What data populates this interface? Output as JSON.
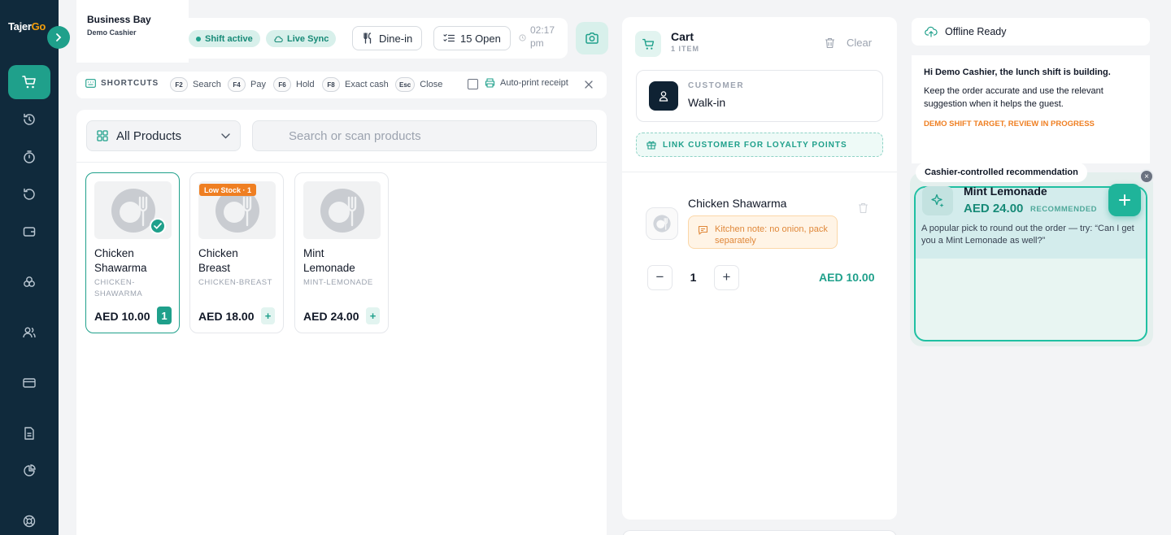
{
  "brand": {
    "name_part1": "Tajer",
    "name_part2": "Go"
  },
  "business": {
    "name": "Business Bay",
    "user": "Demo Cashier"
  },
  "topbar": {
    "shift_status": "Shift active",
    "sync_status": "Live Sync",
    "order_type": "Dine-in",
    "open_orders": "15 Open",
    "time_line1": "02:17",
    "time_line2": "pm"
  },
  "shortcuts": {
    "title": "SHORTCUTS",
    "items": [
      {
        "key": "F2",
        "label": "Search"
      },
      {
        "key": "F4",
        "label": "Pay"
      },
      {
        "key": "F6",
        "label": "Hold"
      },
      {
        "key": "F8",
        "label": "Exact cash"
      },
      {
        "key": "Esc",
        "label": "Close"
      }
    ],
    "auto_print_label": "Auto-print receipt"
  },
  "catalog": {
    "category": "All Products",
    "search_placeholder": "Search or scan products",
    "products": [
      {
        "name_line1": "Chicken",
        "name_line2": "Shawarma",
        "sku_line1": "CHICKEN-",
        "sku_line2": "SHAWARMA",
        "price": "AED 10.00",
        "qty": "1",
        "badge": ""
      },
      {
        "name_line1": "Chicken",
        "name_line2": "Breast",
        "sku_line1": "CHICKEN-BREAST",
        "sku_line2": "",
        "price": "AED 18.00",
        "qty": "",
        "badge": "Low Stock · 1"
      },
      {
        "name_line1": "Mint",
        "name_line2": "Lemonade",
        "sku_line1": "MINT-LEMONADE",
        "sku_line2": "",
        "price": "AED 24.00",
        "qty": "",
        "badge": ""
      }
    ],
    "add_symbol": "+"
  },
  "cart": {
    "title": "Cart",
    "count": "1 ITEM",
    "clear_label": "Clear",
    "customer_label": "CUSTOMER",
    "customer_value": "Walk-in",
    "loyalty_label": "LINK CUSTOMER FOR LOYALTY POINTS",
    "items": [
      {
        "name": "Chicken Shawarma",
        "note": "Kitchen note: no onion, pack separately",
        "qty": "1",
        "price": "AED 10.00"
      }
    ],
    "minus": "−",
    "plus": "+"
  },
  "assistant": {
    "offline_label": "Offline Ready",
    "heading": "Hi Demo Cashier, the lunch shift is building.",
    "body": "Keep the order accurate and use the relevant suggestion when it helps the guest.",
    "target": "DEMO SHIFT TARGET, REVIEW IN PROGRESS"
  },
  "recommendation": {
    "tag": "Cashier-controlled recommendation",
    "name": "Mint Lemonade",
    "price": "AED 24.00",
    "label": "RECOMMENDED",
    "text": "A popular pick to round out the order — try: “Can I get you a Mint Lemonade as well?”",
    "close_symbol": "×"
  },
  "colors": {
    "sidebar": "#102a3c",
    "accent": "#1fa08b",
    "warning": "#ef7f22"
  }
}
